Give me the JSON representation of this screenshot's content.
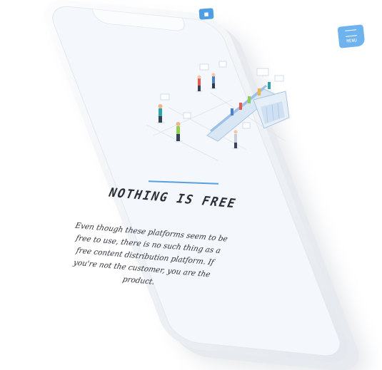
{
  "header": {
    "logo_icon": "chat-bubble-icon",
    "menu_icon": "hamburger-icon",
    "menu_label": "MENU"
  },
  "hero": {
    "illustration": "escalator-people-illustration",
    "title": "NOTHING IS FREE",
    "body": "Even though these platforms seem to be free to use, there is no such thing as a free content distribution platform. If you're not the customer, you are the product."
  },
  "colors": {
    "accent": "#4f9ee3",
    "menu_bg": "#6eb2ee",
    "screen_bg": "#f4f7fb",
    "text": "#2a2f3a"
  }
}
